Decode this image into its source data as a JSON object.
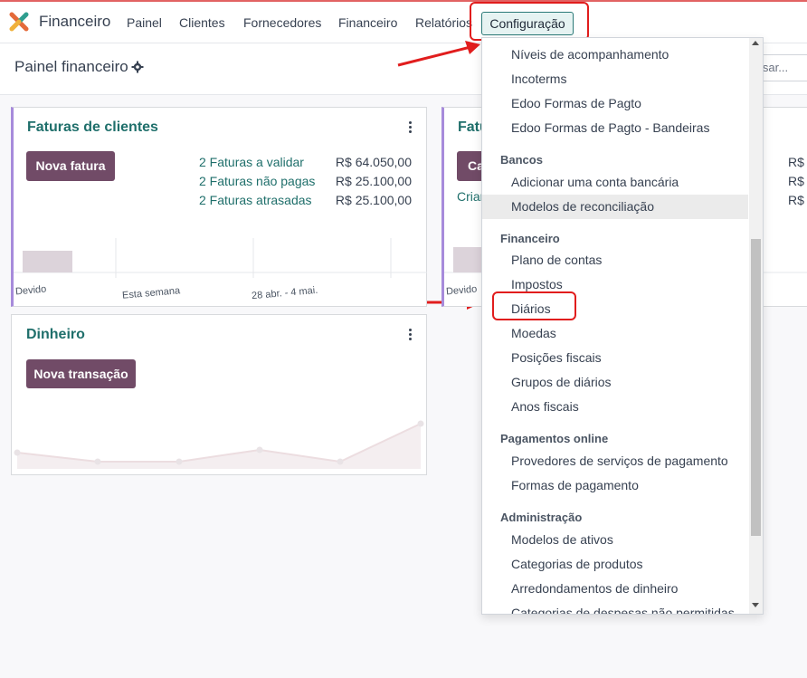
{
  "navbar": {
    "app_name": "Financeiro",
    "menu": [
      "Painel",
      "Clientes",
      "Fornecedores",
      "Financeiro",
      "Relatórios"
    ],
    "config_label": "Configuração"
  },
  "control": {
    "title": "Painel financeiro",
    "search_fragment": "isar..."
  },
  "cards": {
    "invoices": {
      "title": "Faturas de clientes",
      "new_button": "Nova fatura",
      "rows": [
        {
          "label": "2 Faturas a validar",
          "amount": "R$ 64.050,00"
        },
        {
          "label": "2 Faturas não pagas",
          "amount": "R$ 25.100,00"
        },
        {
          "label": "2 Faturas atrasadas",
          "amount": "R$ 25.100,00"
        }
      ],
      "axis": [
        "Devido",
        "Esta semana",
        "28 abr. - 4 mai."
      ]
    },
    "second": {
      "title_fragment": "Fatu",
      "button_fragment": "Ca",
      "link_fragment": "Criar",
      "amount_fragments": [
        "R$",
        "R$",
        "R$"
      ],
      "axis_fragment": "Devido"
    },
    "cash": {
      "title": "Dinheiro",
      "new_button": "Nova transação"
    }
  },
  "dropdown": {
    "top_items": [
      "Níveis de acompanhamento",
      "Incoterms",
      "Edoo Formas de Pagto",
      "Edoo Formas de Pagto - Bandeiras"
    ],
    "sections": [
      {
        "header": "Bancos",
        "items": [
          "Adicionar uma conta bancária",
          "Modelos de reconciliação"
        ]
      },
      {
        "header": "Financeiro",
        "items": [
          "Plano de contas",
          "Impostos",
          "Diários",
          "Moedas",
          "Posições fiscais",
          "Grupos de diários",
          "Anos fiscais"
        ]
      },
      {
        "header": "Pagamentos online",
        "items": [
          "Provedores de serviços de pagamento",
          "Formas de pagamento"
        ]
      },
      {
        "header": "Administração",
        "items": [
          "Modelos de ativos",
          "Categorias de produtos",
          "Arredondamentos de dinheiro",
          "Categorias de despesas não permitidas"
        ]
      }
    ]
  },
  "colors": {
    "brand_primary": "#714b67",
    "accent_teal": "#1f6f6b",
    "highlight_red": "#e11d1d"
  }
}
